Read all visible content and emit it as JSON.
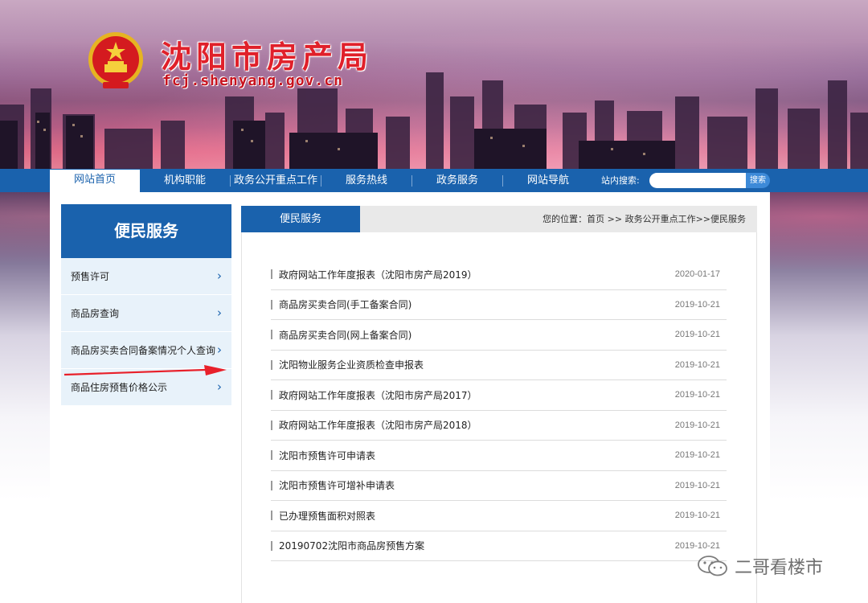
{
  "header": {
    "site_title": "沈阳市房产局",
    "site_domain": "fcj.shenyang.gov.cn"
  },
  "nav": {
    "items": [
      {
        "label": "网站首页",
        "active": true
      },
      {
        "label": "机构职能",
        "active": false
      },
      {
        "label": "政务公开重点工作",
        "active": false
      },
      {
        "label": "服务热线",
        "active": false
      },
      {
        "label": "政务服务",
        "active": false
      },
      {
        "label": "网站导航",
        "active": false
      }
    ],
    "search_label": "站内搜索:",
    "search_value": "",
    "search_button": "搜索"
  },
  "sidebar": {
    "title": "便民服务",
    "items": [
      {
        "label": "预售许可"
      },
      {
        "label": "商品房查询"
      },
      {
        "label": "商品房买卖合同备案情况个人查询"
      },
      {
        "label": "商品住房预售价格公示"
      }
    ]
  },
  "main": {
    "tab_label": "便民服务",
    "breadcrumb": "您的位置：首页 >> 政务公开重点工作>>便民服务",
    "rows": [
      {
        "title": "政府网站工作年度报表（沈阳市房产局2019）",
        "date": "2020-01-17"
      },
      {
        "title": "商品房买卖合同(手工备案合同)",
        "date": "2019-10-21"
      },
      {
        "title": "商品房买卖合同(网上备案合同)",
        "date": "2019-10-21"
      },
      {
        "title": "沈阳物业服务企业资质检查申报表",
        "date": "2019-10-21"
      },
      {
        "title": "政府网站工作年度报表（沈阳市房产局2017）",
        "date": "2019-10-21"
      },
      {
        "title": "政府网站工作年度报表（沈阳市房产局2018）",
        "date": "2019-10-21"
      },
      {
        "title": "沈阳市预售许可申请表",
        "date": "2019-10-21"
      },
      {
        "title": "沈阳市预售许可增补申请表",
        "date": "2019-10-21"
      },
      {
        "title": "已办理预售面积对照表",
        "date": "2019-10-21"
      },
      {
        "title": "20190702沈阳市商品房预售方案",
        "date": "2019-10-21"
      }
    ]
  },
  "watermark": {
    "text": "二哥看楼市",
    "icon": "wechat-icon"
  },
  "colors": {
    "brand_blue": "#1a62ad",
    "title_red": "#e0202a",
    "annotation_red": "#e8202a"
  }
}
